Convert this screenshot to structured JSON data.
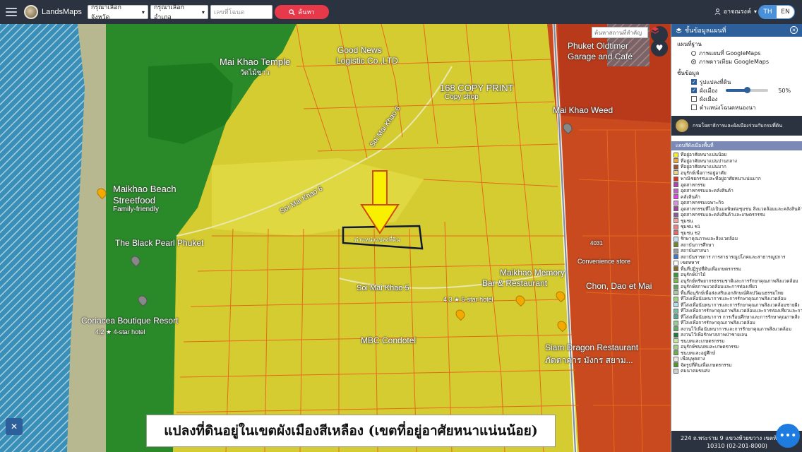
{
  "topbar": {
    "brand": "LandsMaps",
    "province_select": "กรุณาเลือกจังหวัด",
    "district_select": "กรุณาเลือกอำเภอ",
    "deed_placeholder": "เลขที่โฉนด",
    "search_label": "ค้นหา",
    "user_name": "อาจณรงค์",
    "lang_th": "TH",
    "lang_en": "EN"
  },
  "map": {
    "place_search_placeholder": "ค้นหาสถานที่สำคัญ",
    "labels": {
      "mai_khao_temple": "Mai Khao Temple",
      "wat": "วัดไม้ขาว",
      "good_news": "Good News",
      "logistic": "Logistic Co.,LTD",
      "copy_print": "168 COPY PRINT",
      "copy_shop": "Copy shop",
      "phuket_oldtimer": "Phuket Oldtimer",
      "garage_cafe": "Garage and Café",
      "mai_khao_weed": "Mai Khao Weed",
      "soi_mai_khao_6a": "Soi Mai Khao 6",
      "soi_mai_khao_6b": "Soi Mai Khao 6",
      "maikhao_beach": "Maikhao Beach",
      "streetfood": "Streetfood",
      "family": "Family-friendly",
      "black_pearl": "The Black Pearl Phuket",
      "coriacea": "Coriacea Boutique Resort",
      "coriacea_rating": "4.2 ★ 4-star hotel",
      "soi_mai_khao_5": "Soi Mai Khao 5",
      "five_star": "4.3 ★ 5-star hotel",
      "maikhao_memory": "Maikhao Memory",
      "bar_restaurant": "Bar & Restaurant",
      "chon": "Chon, Dao et Mai",
      "convenience": "Convenience store",
      "mbc": "MBC Condotel",
      "siam_dragon": "Siam Dragon Restaurant",
      "siam_dragon_th": "ภัตตาคาร มังกร สยาม...",
      "road": "4031"
    },
    "plot_label": "ตำแหน่งแปลงที่ดิน",
    "caption": "แปลงที่ดินอยู่ในเขตผังเมืองสีเหลือง (เขตที่อยู่อาศัยหนาแน่นน้อย)"
  },
  "panel": {
    "title": "ชั้นข้อมูลแผนที่",
    "basemap_heading": "แผนที่ฐาน",
    "basemap_options": [
      "ภาพแผนที่ GoogleMaps",
      "ภาพดาวเทียม GoogleMaps"
    ],
    "basemap_selected": 1,
    "layers_heading": "ชั้นข้อมูล",
    "layers": [
      {
        "label": "รูปแปลงที่ดิน",
        "checked": true
      },
      {
        "label": "ผังเมือง",
        "checked": true
      },
      {
        "label": "ผังเมือง",
        "checked": false
      },
      {
        "label": "ตำแหน่งโฉนดหนองนา",
        "checked": false
      }
    ],
    "opacity": "50%",
    "opacity_value": 50,
    "dept_name": "กรมโยธาธิการและผังเมืองร่วมกับกรมที่ดิน",
    "legend_title": "แถบสีผังเมืองพื้นที่",
    "legend": [
      {
        "label": "ที่อยู่อาศัยหนาแน่นน้อย",
        "color": "#f6f21e"
      },
      {
        "label": "ที่อยู่อาศัยหนาแน่นปานกลาง",
        "color": "#f2a43a"
      },
      {
        "label": "ที่อยู่อาศัยหนาแน่นมาก",
        "color": "#a0522d"
      },
      {
        "label": "อนุรักษ์เพื่อการอยู่อาศัย",
        "color": "#e8d38a"
      },
      {
        "label": "พาณิชยกรรมและที่อยู่อาศัยหนาแน่นมาก",
        "color": "#e0301e"
      },
      {
        "label": "อุตสาหกรรม",
        "color": "#b040b0"
      },
      {
        "label": "อุตสาหกรรมและคลังสินค้า",
        "color": "#c060c8"
      },
      {
        "label": "คลังสินค้า",
        "color": "#e040e0"
      },
      {
        "label": "อุตสาหกรรมเฉพาะกิจ",
        "color": "#d890e0"
      },
      {
        "label": "อุตสาหกรรมที่ไม่เป็นมลพิษต่อชุมชน สิ่งแวดล้อมและคลังสินค้า",
        "color": "#a040a0"
      },
      {
        "label": "อุตสาหกรรมและคลังสินค้าและเกษตรกรรม",
        "color": "#8a5a9a"
      },
      {
        "label": "ชุมชน",
        "color": "#f4a0a0"
      },
      {
        "label": "ชุมชน ช1",
        "color": "#f08080"
      },
      {
        "label": "ชุมชน ช2",
        "color": "#e86868"
      },
      {
        "label": "รักษาคุณภาพและสิ่งแวดล้อม",
        "color": "#c0e0f0"
      },
      {
        "label": "สถาบันการศึกษา",
        "color": "#6a8a2a"
      },
      {
        "label": "สถาบันศาสนา",
        "color": "#9a9a9a"
      },
      {
        "label": "สถาบันราชการ การสาธารณูปโภคและสาธารณูปการ",
        "color": "#3a7ac8"
      },
      {
        "label": "เขตทหาร",
        "color": "#ffffff"
      },
      {
        "label": "พื้นที่ปฏิรูปที่ดินเพื่อเกษตรกรรม",
        "color": "#8a6a2a"
      },
      {
        "label": "อนุรักษ์ป่าไม้",
        "color": "#3a9a3a"
      },
      {
        "label": "อนุรักษ์ทรัพยากรธรรมชาติและการรักษาคุณภาพสิ่งแวดล้อม",
        "color": "#7ab84a"
      },
      {
        "label": "อนุรักษ์สภาพแวดล้อมและการท่องเที่ยว",
        "color": "#5aa85a"
      },
      {
        "label": "พื้นที่อนุรักษ์เพื่อส่งเสริมเอกลักษณ์ศิลปวัฒนธรรมไทย",
        "color": "#a8c8a0"
      },
      {
        "label": "ที่โล่งเพื่อนันทนาการและการรักษาคุณภาพสิ่งแวดล้อม",
        "color": "#9ad87a"
      },
      {
        "label": "ที่โล่งเพื่อนันทนาการและการรักษาคุณภาพสิ่งแวดล้อมชายฝั่ง",
        "color": "#b0e0f0"
      },
      {
        "label": "ที่โล่งเพื่อการรักษาคุณภาพสิ่งแวดล้อมและการท่องเที่ยวและการ",
        "color": "#70c0a0"
      },
      {
        "label": "ที่โล่งเพื่อนันทนาการ การเรือนศึกษาและการรักษาคุณภาพสิ่ง",
        "color": "#50a890"
      },
      {
        "label": "ที่โล่งเพื่อการรักษาคุณภาพสิ่งแวดล้อม",
        "color": "#90d090"
      },
      {
        "label": "สงวนไว้เพื่อนันทนาการและการรักษาคุณภาพสิ่งแวดล้อม",
        "color": "#60b060"
      },
      {
        "label": "สงวนไว้เพื่อรักษาสภาพป่าชายเลน",
        "color": "#1a7a3a"
      },
      {
        "label": "ชนบทและเกษตรกรรม",
        "color": "#c8e8a0"
      },
      {
        "label": "อนุรักษ์ชนบทและเกษตรกรรม",
        "color": "#a0d080"
      },
      {
        "label": "ชนบทและอยู่ศึกษ์",
        "color": "#6ab04a"
      },
      {
        "label": "เพื่อนุษุคตาง",
        "color": "#e8e8e8"
      },
      {
        "label": "จัดรูปที่ดินเพื่อเกษตรกรรม",
        "color": "#4a9a2a"
      },
      {
        "label": "คมนาคมขนส่ง",
        "color": "#d0d0d0"
      }
    ],
    "footer_line1": "224 ถ.พระราม 9 แขวงห้วยขวาง เขตห้วยขวา",
    "footer_line2": "10310 (02-201-8000)"
  },
  "colors": {
    "topbar": "#2b3340",
    "accent": "#2d5f9a",
    "search_button": "#e8394a",
    "zone_yellow": "#f6f21e",
    "zone_red": "#e0301e",
    "forest_green": "#2a8a2a",
    "parcel_line": "#e8681e"
  },
  "icons": [
    "hamburger-icon",
    "logo-icon",
    "search-icon",
    "user-icon",
    "layers-icon",
    "heart-icon",
    "close-icon",
    "seal-icon",
    "tools-icon",
    "chat-icon",
    "arrow-icon"
  ]
}
